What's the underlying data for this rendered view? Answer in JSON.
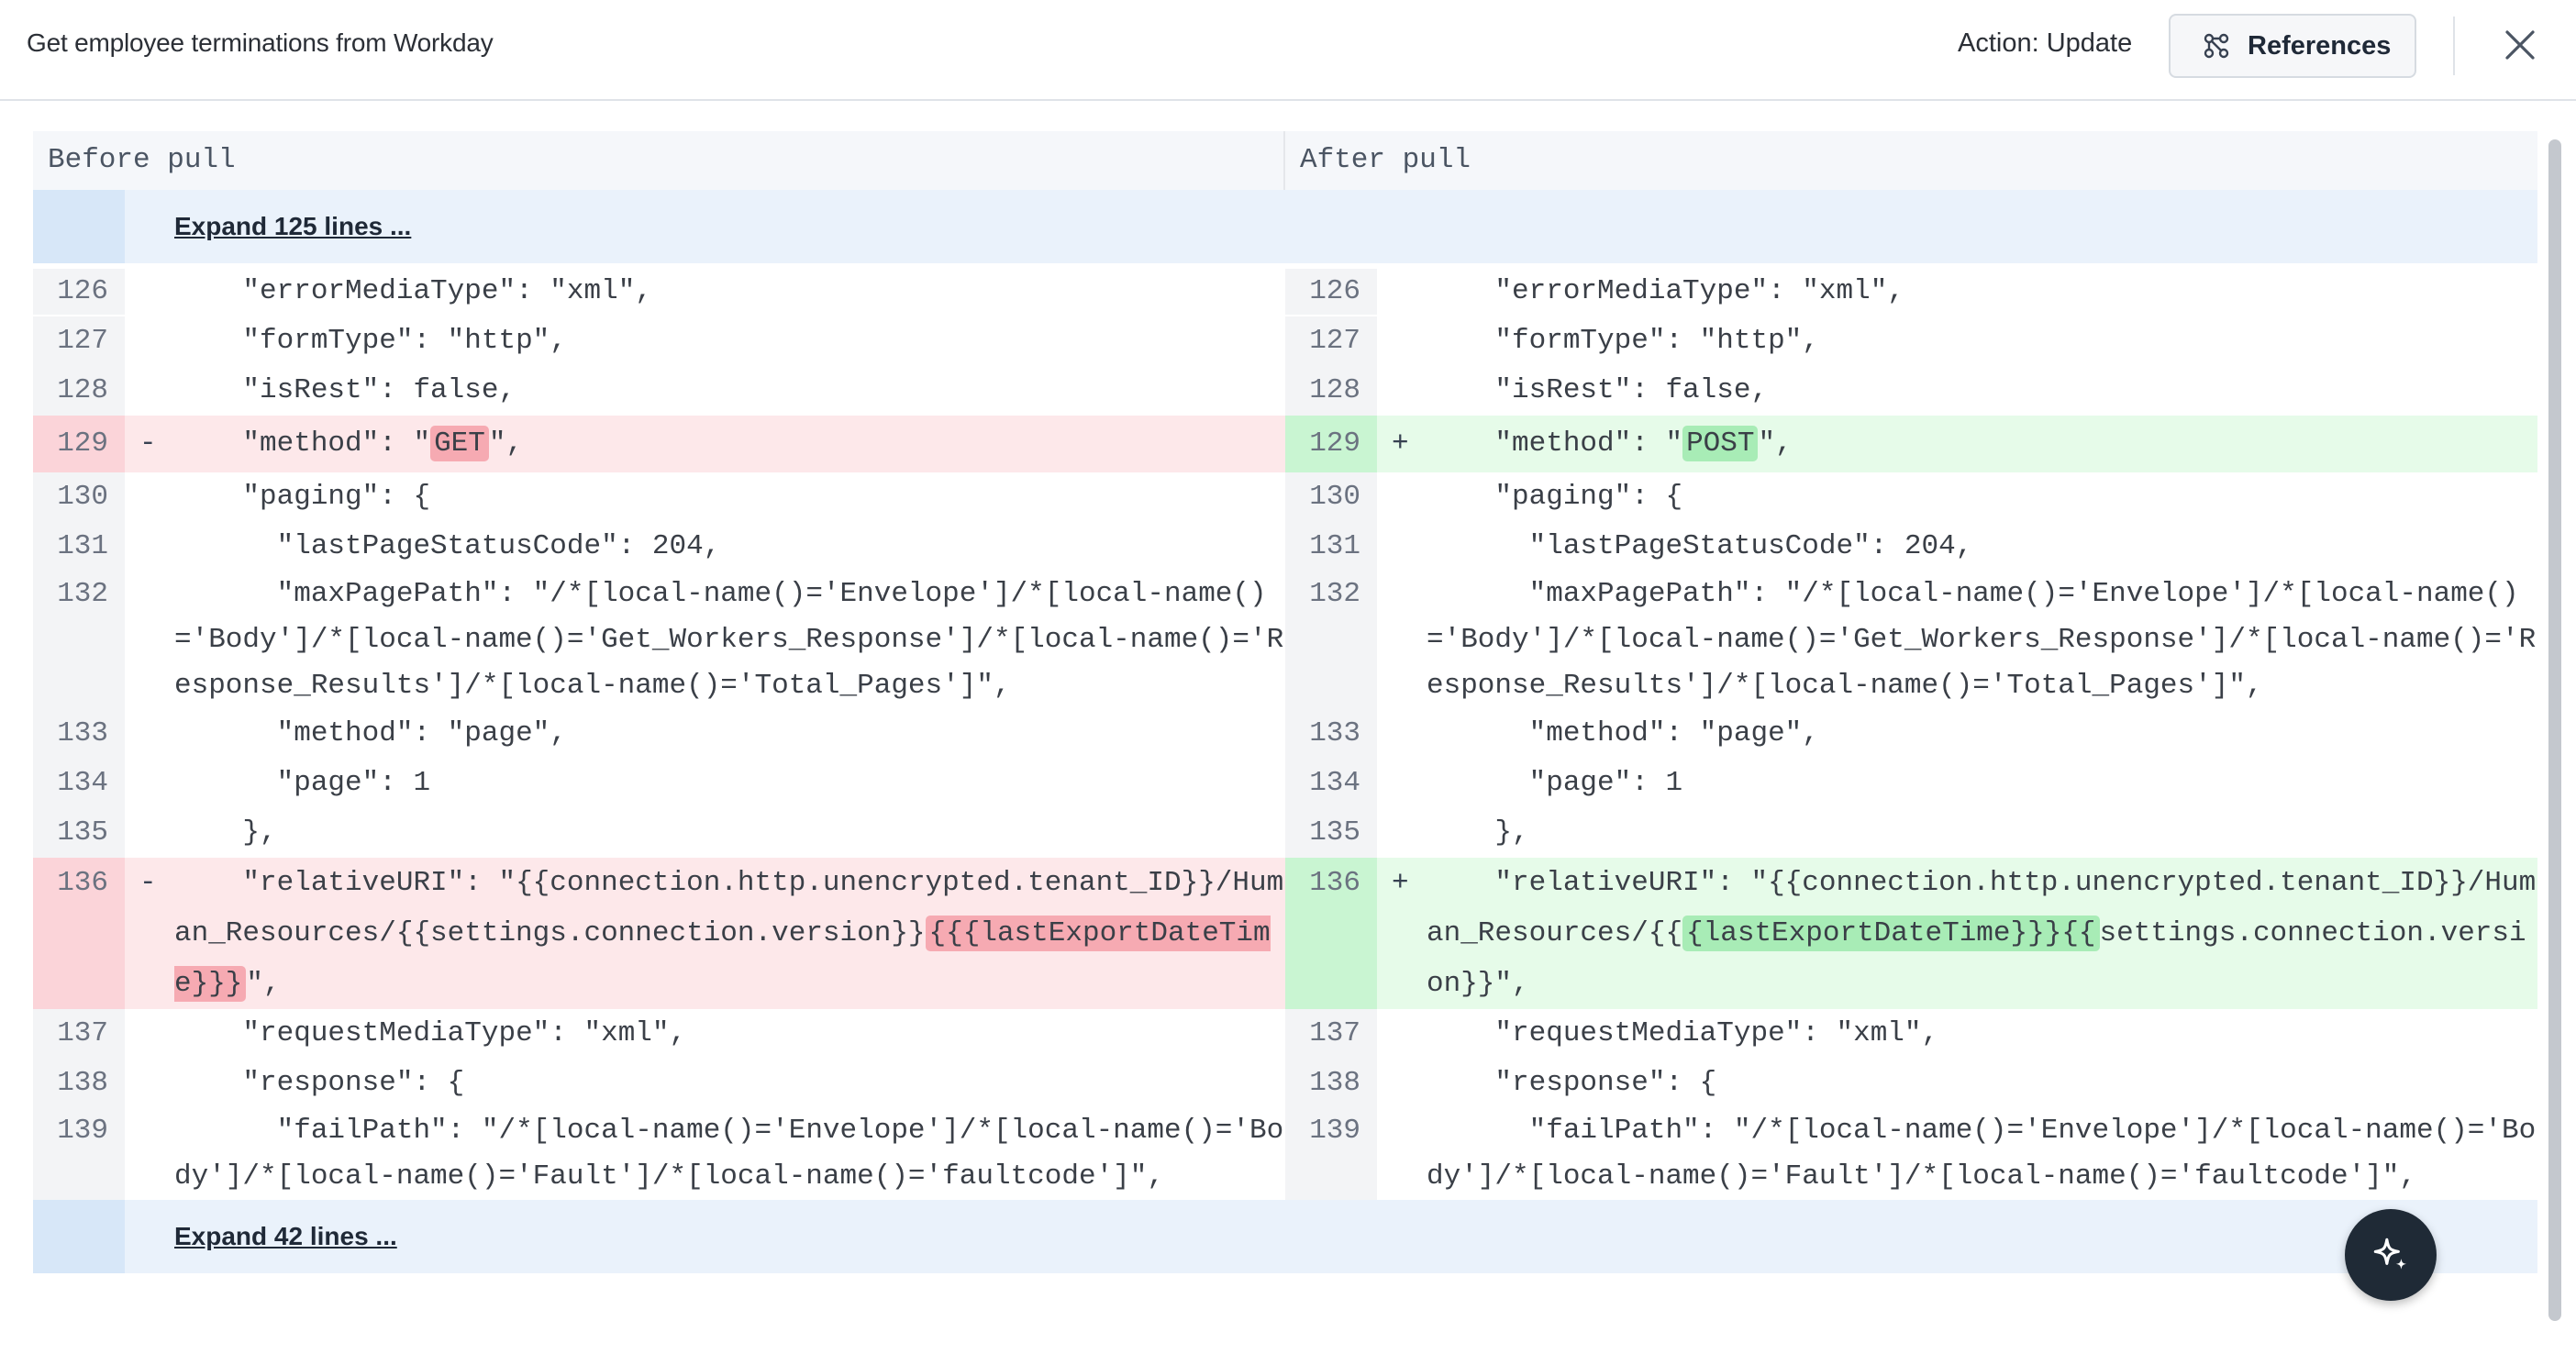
{
  "header": {
    "title": "Get employee terminations from Workday",
    "action": "Action: Update",
    "references_label": "References"
  },
  "diff": {
    "before_label": "Before pull",
    "after_label": "After pull",
    "expand_top": "Expand 125 lines ...",
    "expand_bottom": "Expand 42 lines ...",
    "lines": {
      "l126": "    \"errorMediaType\": \"xml\",",
      "l127": "    \"formType\": \"http\",",
      "l128": "    \"isRest\": false,",
      "l129_pre": "    \"method\": \"",
      "l129_old": "GET",
      "l129_new": "POST",
      "l129_post": "\",",
      "l130": "    \"paging\": {",
      "l131": "      \"lastPageStatusCode\": 204,",
      "l132": "      \"maxPagePath\": \"/*[local-name()='Envelope']/*[local-name()='Body']/*[local-name()='Get_Workers_Response']/*[local-name()='Response_Results']/*[local-name()='Total_Pages']\",",
      "l133": "      \"method\": \"page\",",
      "l134": "      \"page\": 1",
      "l135": "    },",
      "l136_pre": "    \"relativeURI\": \"{{connection.http.unencrypted.tenant_ID}}/Human_Resources/{{",
      "l136_old_mid": "settings.connection.version}}",
      "l136_old_hl": "{{{lastExportDateTime}}}",
      "l136_new_hl": "{lastExportDateTime}}}{{",
      "l136_new_mid": "settings.connection.version}}",
      "l136_post": "\",",
      "l137": "    \"requestMediaType\": \"xml\",",
      "l138": "    \"response\": {",
      "l139": "      \"failPath\": \"/*[local-name()='Envelope']/*[local-name()='Body']/*[local-name()='Fault']/*[local-name()='faultcode']\","
    },
    "numbers": [
      "126",
      "127",
      "128",
      "129",
      "130",
      "131",
      "132",
      "133",
      "134",
      "135",
      "136",
      "137",
      "138",
      "139"
    ],
    "del_mark": "-",
    "add_mark": "+"
  },
  "colors": {
    "deleted_bg": "#fde8ea",
    "added_bg": "#e6fbe9",
    "deleted_highlight": "#f6aab2",
    "added_highlight": "#a8ecb6"
  }
}
